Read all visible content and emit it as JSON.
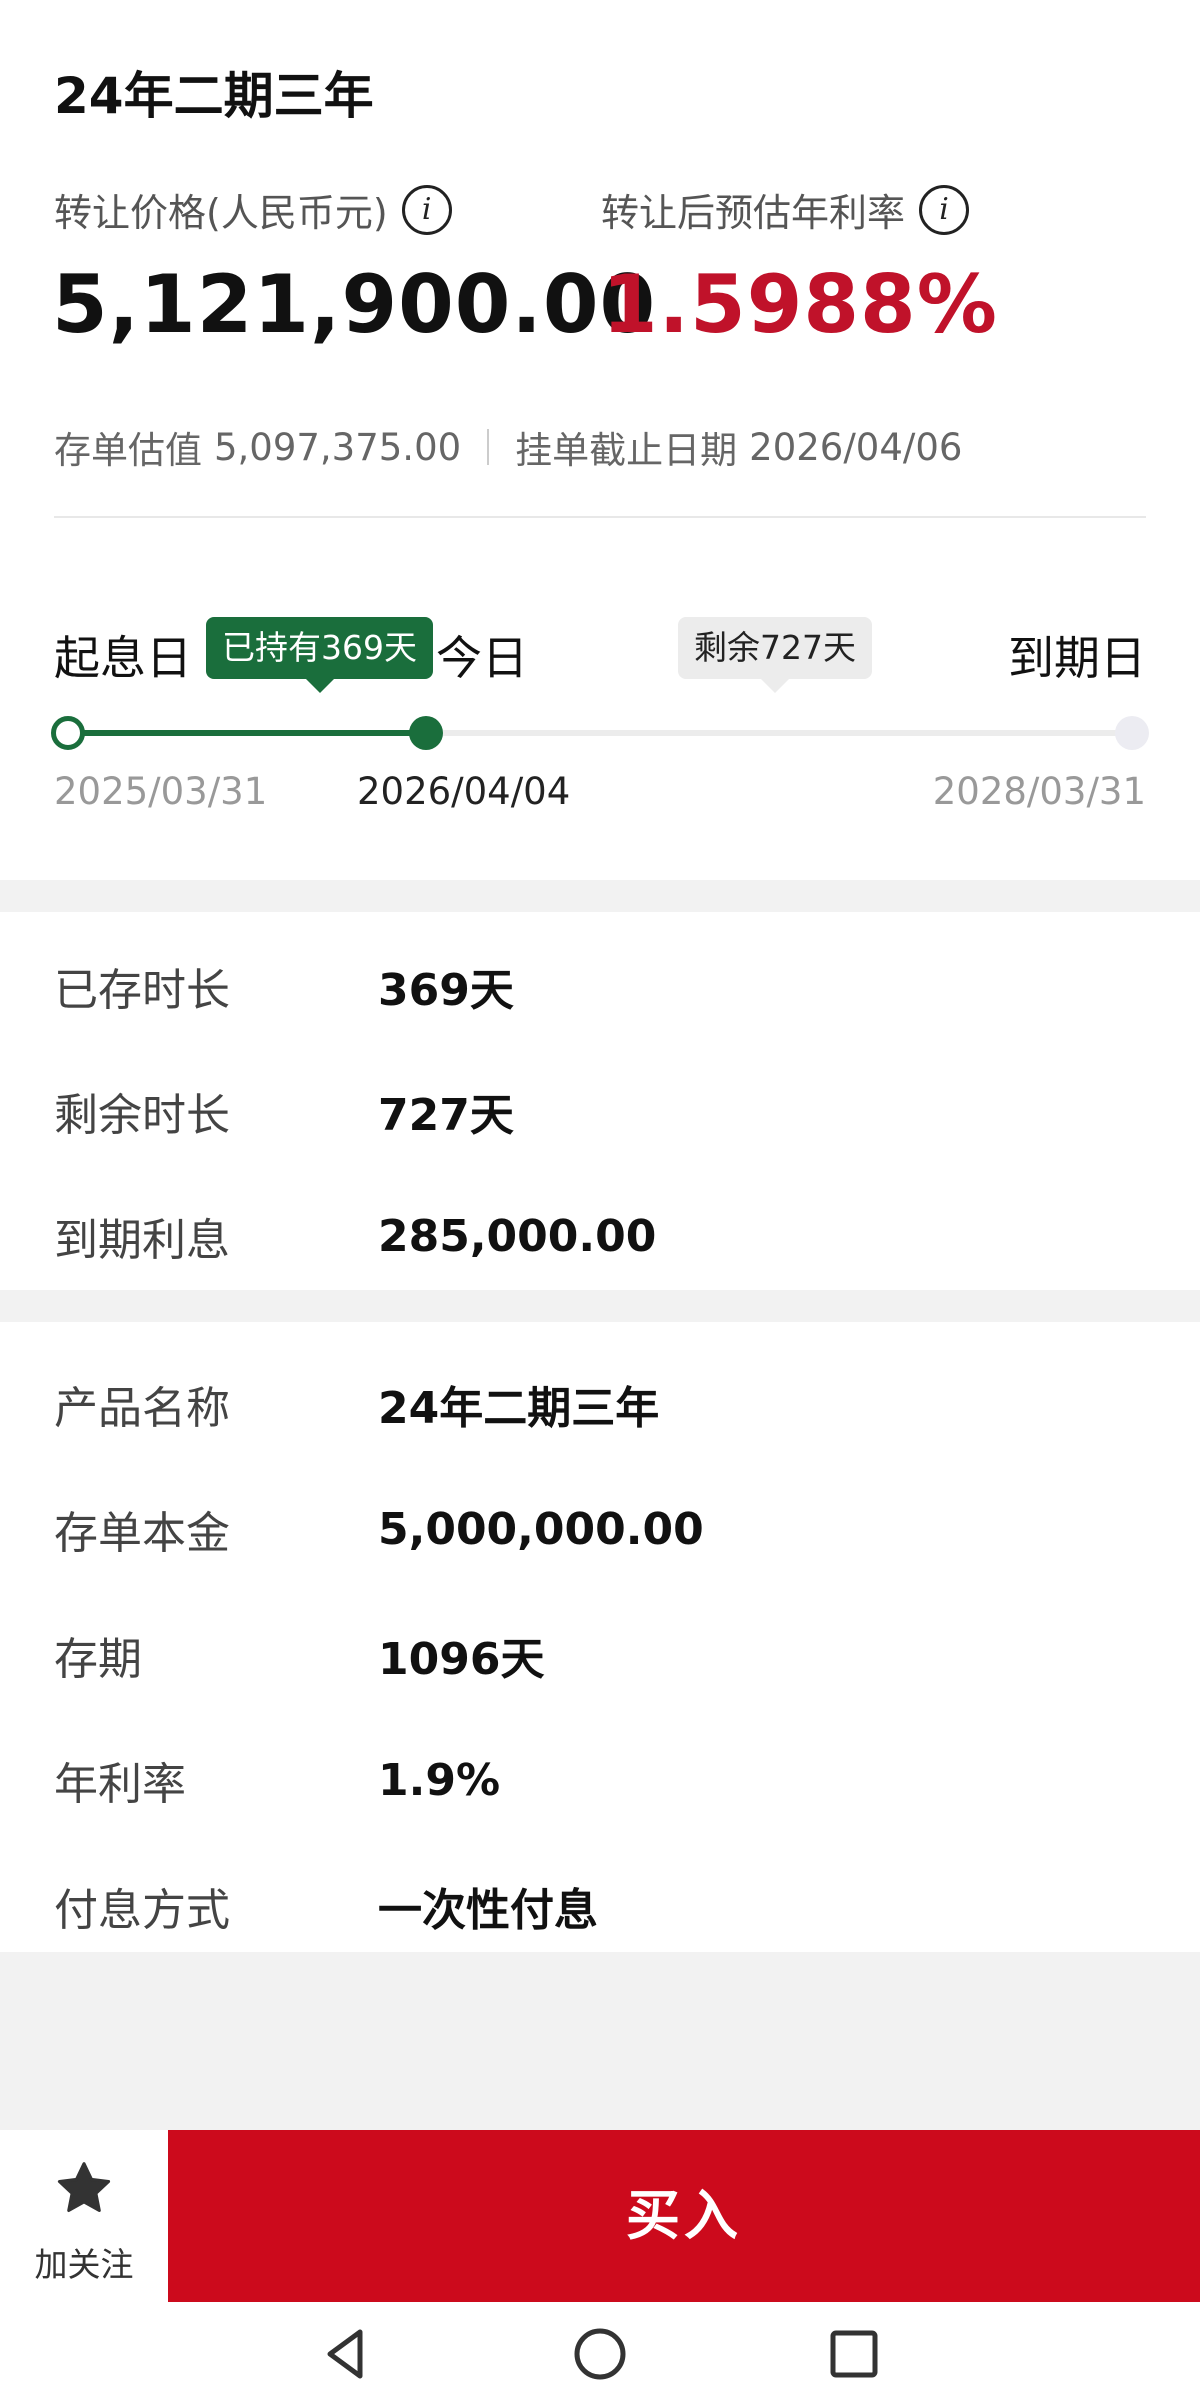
{
  "product": {
    "title": "24年二期三年"
  },
  "price": {
    "transfer_label": "转让价格(人民币元)",
    "transfer_value": "5,121,900.00",
    "rate_label": "转让后预估年利率",
    "rate_value": "1.5988%",
    "info_glyph": "i"
  },
  "meta": {
    "valuation_label": "存单估值",
    "valuation_value": "5,097,375.00",
    "deadline_label": "挂单截止日期",
    "deadline_value": "2026/04/06"
  },
  "timeline": {
    "start_label": "起息日",
    "today_label": "今日",
    "end_label": "到期日",
    "held_badge": "已持有369天",
    "remaining_badge": "剩余727天",
    "start_date": "2025/03/31",
    "today_date": "2026/04/04",
    "end_date": "2028/03/31",
    "progress_fraction": 0.3367,
    "accent_color": "#1a6e3c"
  },
  "holding": [
    {
      "label": "已存时长",
      "value": "369天"
    },
    {
      "label": "剩余时长",
      "value": "727天"
    },
    {
      "label": "到期利息",
      "value": "285,000.00"
    }
  ],
  "details": [
    {
      "label": "产品名称",
      "value": "24年二期三年"
    },
    {
      "label": "存单本金",
      "value": "5,000,000.00"
    },
    {
      "label": "存期",
      "value": "1096天"
    },
    {
      "label": "年利率",
      "value": "1.9%"
    },
    {
      "label": "付息方式",
      "value": "一次性付息"
    }
  ],
  "actions": {
    "follow_label": "加关注",
    "follow_icon": "star-icon",
    "buy_label": "买入",
    "buy_color": "#cc0a1c"
  },
  "system_nav": {
    "icons": [
      "back-icon",
      "home-icon",
      "recents-icon"
    ]
  }
}
